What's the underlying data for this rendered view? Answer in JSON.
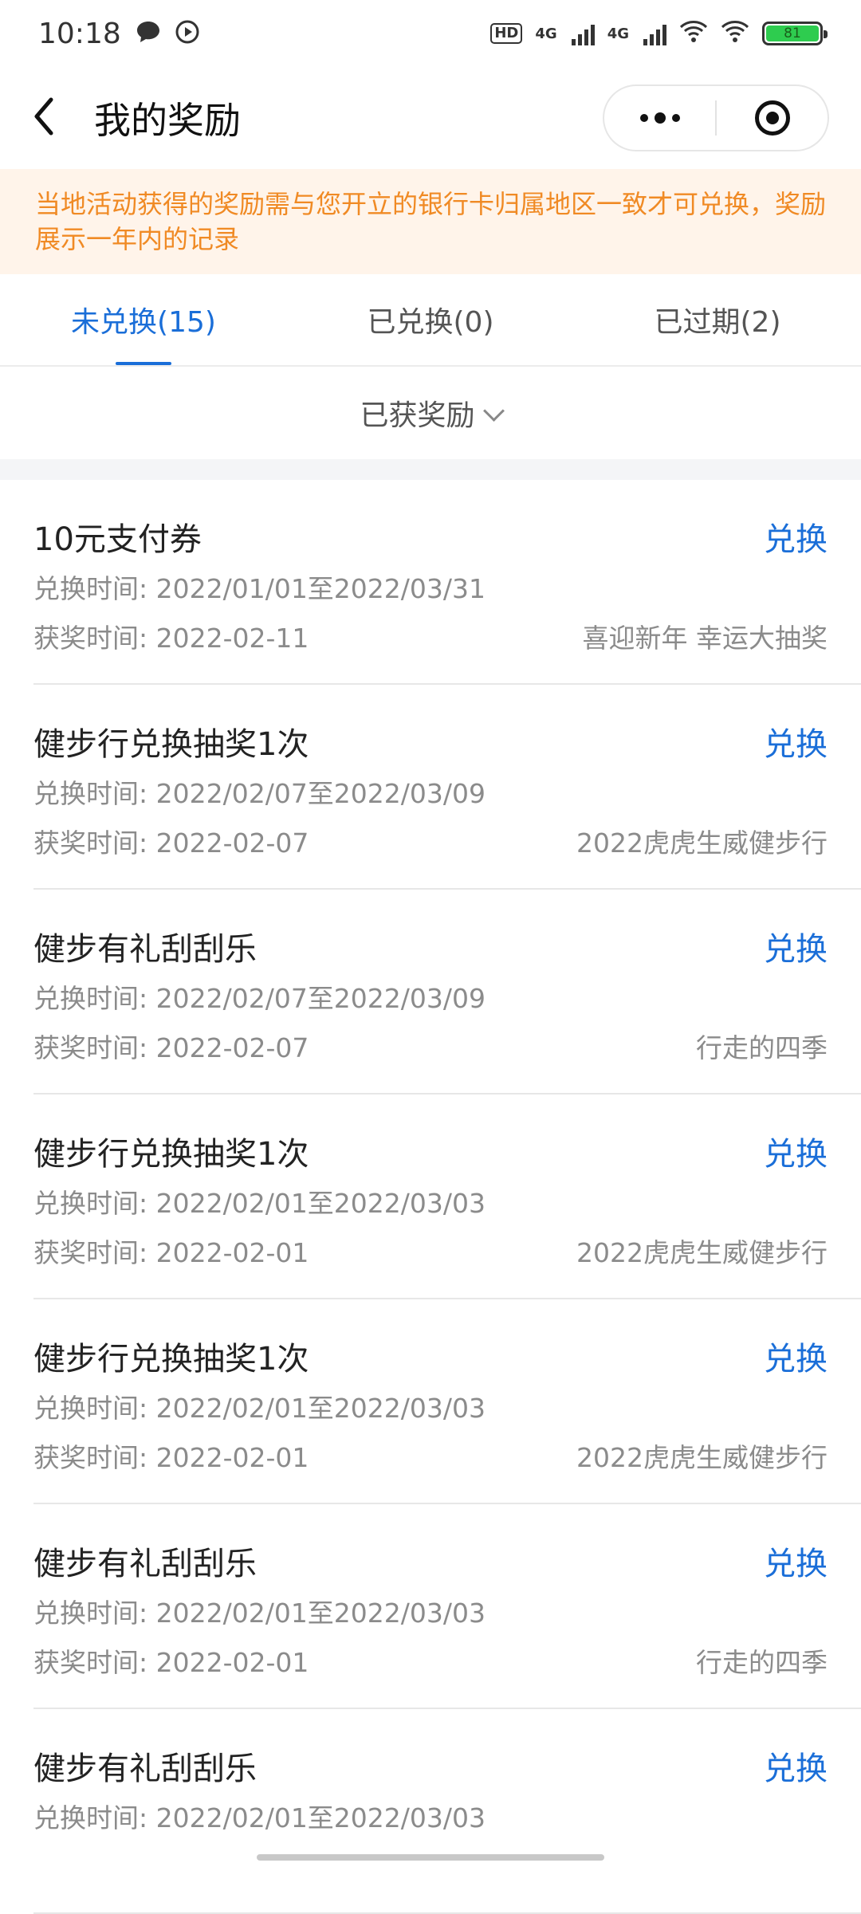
{
  "status_bar": {
    "time": "10:18",
    "hd": "HD",
    "net1": "4G",
    "net2": "4G",
    "battery": "81",
    "icons": [
      "message-icon",
      "play-icon",
      "hd-icon",
      "signal-icon",
      "wifi-icon",
      "battery-icon"
    ]
  },
  "nav": {
    "title": "我的奖励",
    "icons": [
      "back-icon",
      "more-dots-icon",
      "target-close-icon"
    ]
  },
  "notice": "当地活动获得的奖励需与您开立的银行卡归属地区一致才可兑换，奖励展示一年内的记录",
  "tabs": [
    {
      "label": "未兑换(15)",
      "active": true
    },
    {
      "label": "已兑换(0)",
      "active": false
    },
    {
      "label": "已过期(2)",
      "active": false
    }
  ],
  "filter": {
    "label": "已获奖励"
  },
  "items": [
    {
      "name": "10元支付券",
      "action": "兑换",
      "period": "兑换时间: 2022/01/01至2022/03/31",
      "won": "获奖时间: 2022-02-11",
      "source": "喜迎新年 幸运大抽奖"
    },
    {
      "name": "健步行兑换抽奖1次",
      "action": "兑换",
      "period": "兑换时间: 2022/02/07至2022/03/09",
      "won": "获奖时间: 2022-02-07",
      "source": "2022虎虎生威健步行"
    },
    {
      "name": "健步有礼刮刮乐",
      "action": "兑换",
      "period": "兑换时间: 2022/02/07至2022/03/09",
      "won": "获奖时间: 2022-02-07",
      "source": "行走的四季"
    },
    {
      "name": "健步行兑换抽奖1次",
      "action": "兑换",
      "period": "兑换时间: 2022/02/01至2022/03/03",
      "won": "获奖时间: 2022-02-01",
      "source": "2022虎虎生威健步行"
    },
    {
      "name": "健步行兑换抽奖1次",
      "action": "兑换",
      "period": "兑换时间: 2022/02/01至2022/03/03",
      "won": "获奖时间: 2022-02-01",
      "source": "2022虎虎生威健步行"
    },
    {
      "name": "健步有礼刮刮乐",
      "action": "兑换",
      "period": "兑换时间: 2022/02/01至2022/03/03",
      "won": "获奖时间: 2022-02-01",
      "source": "行走的四季"
    },
    {
      "name": "健步有礼刮刮乐",
      "action": "兑换",
      "period": "兑换时间: 2022/02/01至2022/03/03",
      "won": "",
      "source": ""
    }
  ],
  "colors": {
    "accent": "#1a6ed8",
    "notice_text": "#f08a24",
    "notice_bg": "#fff4ea",
    "battery": "#2ecc4f"
  }
}
